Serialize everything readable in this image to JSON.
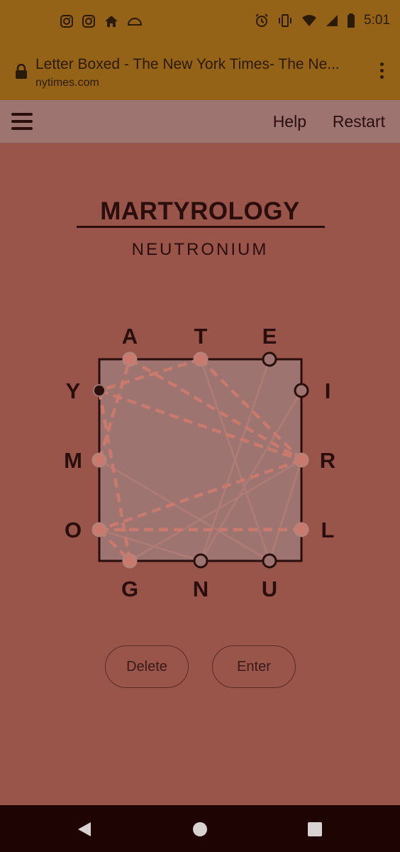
{
  "status_bar": {
    "time": "5:01",
    "left_icons": [
      "instagram-icon",
      "instagram-icon",
      "home-icon",
      "cloud-icon"
    ],
    "right_icons": [
      "alarm-icon",
      "vibrate-icon",
      "wifi-icon",
      "signal-icon",
      "battery-icon"
    ]
  },
  "browser": {
    "title": "Letter Boxed - The New York Times- The Ne...",
    "domain": "nytimes.com"
  },
  "header": {
    "help_label": "Help",
    "restart_label": "Restart"
  },
  "game": {
    "current_word": "MARTYROLOGY",
    "next_word": "NEUTRONIUM",
    "letters": {
      "top": [
        "A",
        "T",
        "E"
      ],
      "right": [
        "I",
        "R",
        "L"
      ],
      "bottom": [
        "G",
        "N",
        "U"
      ],
      "left": [
        "Y",
        "M",
        "O"
      ]
    }
  },
  "buttons": {
    "delete_label": "Delete",
    "enter_label": "Enter"
  },
  "colors": {
    "background": "#9a554b",
    "browser_bar": "#946317",
    "header": "#9e7470",
    "box_fill": "#9e7470",
    "dark": "#2a0e0c",
    "path": "#c97a6c",
    "nav_bar": "#1e0403"
  }
}
